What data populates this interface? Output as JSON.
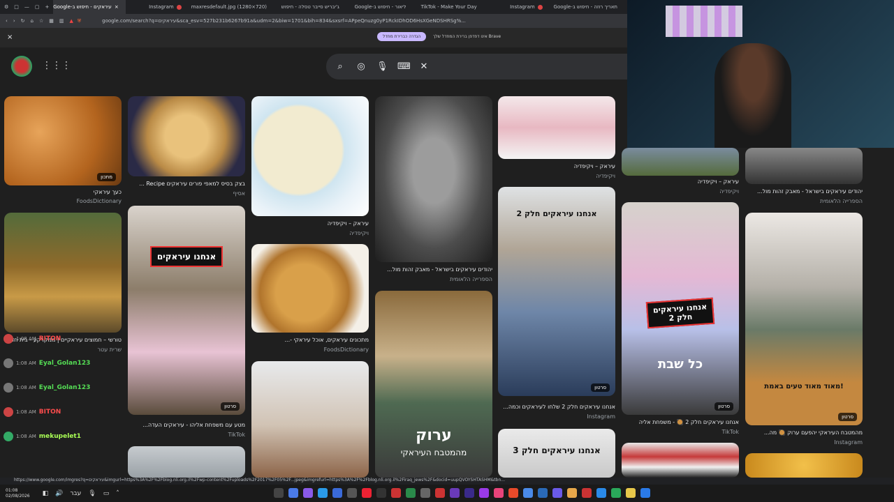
{
  "tabs": [
    {
      "label": "עיראקים - חיפוש ב-Google",
      "active": true
    },
    {
      "label": "Instagram"
    },
    {
      "label": "maxresdefault.jpg (1280×720)"
    },
    {
      "label": "ג'יבריש סייבר טסלה - חיפוש"
    },
    {
      "label": "ליאור - חיפוש ב-Google"
    },
    {
      "label": "TikTok - Make Your Day"
    },
    {
      "label": "Instagram"
    },
    {
      "label": "תאריך רוזה - חיפוש ב-Google"
    }
  ],
  "address": {
    "url": "google.com/search?q=עיראקים&sca_esv=527b231b6267b91a&udm=2&biw=1701&bih=834&sxsrf=APpeQnuzg0yP1RckIDhOD6HsXGeNDSHRSg%..."
  },
  "infobar": {
    "button": "הגדרה כברירת מחדל",
    "message": "אינו דפדפן ברירת המחדל שלך Brave"
  },
  "results": [
    {
      "caption": "כעך עיראקי",
      "source": "FoodsDictionary",
      "badge": "מתכון"
    },
    {
      "caption": "בצק בסיס למאפי פורים עיראקים Recipe ...",
      "source": "אסיף"
    },
    {
      "caption": "עיראק – ויקיפדיה",
      "source": "ויקיפדיה"
    },
    {
      "caption": "יהודים עיראקים בישראל - מאבק זהות מול...",
      "source": "הספרייה הלאומית"
    },
    {
      "caption": "עיראק – ויקיפדיה",
      "source": "ויקיפדיה"
    },
    {
      "caption": "עיראק – ויקיפדיה",
      "source": "ויקיפדיה"
    },
    {
      "caption": "יהודים עיראקים בישראל - מאבק זהות מול...",
      "source": "הספרייה הלאומית"
    },
    {
      "caption": "טורשי – חמוצים עיראקיים | ממקרקע - בית חד משתמש",
      "source": "שרית עטר"
    },
    {
      "caption": "מטע עם משפחת אליהו - עיראקים העדה...",
      "source": "TikTok",
      "badge": "סרטון",
      "overlay": "אנחנו עיראקים"
    },
    {
      "caption": "מתכונים עיראקים, אוכל עיראקי -...",
      "source": "FoodsDictionary"
    },
    {
      "caption": "אנחנו עיראקים חלק 2 שלחו לעיראקים וכמה...",
      "source": "Instagram",
      "badge": "סרטון",
      "overlay": "אנחנו עיראקים חלק 2"
    },
    {
      "caption": "אנחנו עיראקים חלק 2 🥘 - משפחת אליה",
      "source": "TikTok",
      "badge": "סרטון",
      "overlay": "אנחנו עיראקים חלק 2",
      "overlay2": "כל שבת"
    },
    {
      "caption": "מהמטבח העיראקי יהפעם ערוק 🥘 מה...",
      "source": "Instagram",
      "badge": "סרטון",
      "overlay": "מאוד מאוד טעים באמת!"
    },
    {
      "overlay": "ערוק",
      "overlay2": "מהמטבח העיראקי"
    },
    {
      "overlay": "אנחנו עיראקים חלק 3"
    }
  ],
  "chat": [
    {
      "time": "1:08 AM",
      "user": "BITON",
      "color": "#ff4d4d"
    },
    {
      "time": "1:08 AM",
      "user": "Eyal_Golan123",
      "color": "#55dd55"
    },
    {
      "time": "1:08 AM",
      "user": "Eyal_Golan123",
      "color": "#55dd55"
    },
    {
      "time": "1:08 AM",
      "user": "BITON",
      "color": "#ff4d4d"
    },
    {
      "time": "1:08 AM",
      "user": "mekupelet1",
      "color": "#aaff55"
    }
  ],
  "statusbar": "https://www.google.com/imgres?q=עיראקים&imgurl=https%3A%2F%2Fblog.nli.org.il%2Fwp-content%2Fuploads%2F2017%2F05%2F...jpeg&imgrefurl=https%3A%2F%2Fblog.nli.org.il%2Firaq_jews%2F&docid=uupQVOYSHTASHM&tbn...",
  "taskbar": {
    "time": "01:08",
    "date": "02/08/2026",
    "lang": "עבר"
  },
  "colors": {
    "bg": "#1f1f1f",
    "search": "#303134",
    "accent": "#c8b8ff"
  }
}
